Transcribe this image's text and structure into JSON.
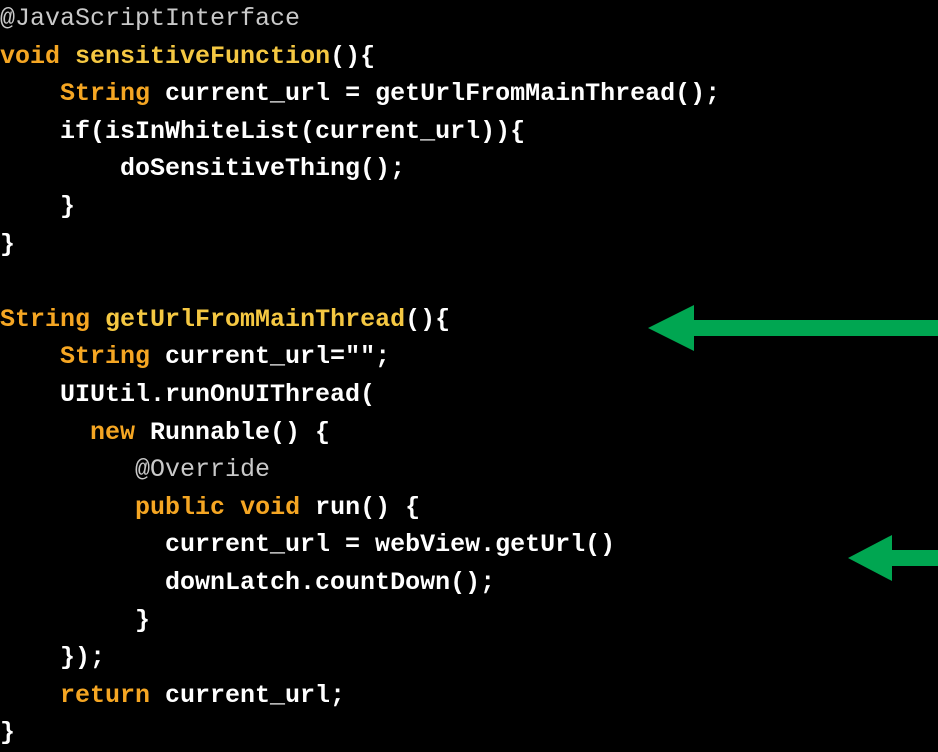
{
  "code_lines": [
    [
      {
        "t": "@JavaScriptInterface",
        "k": "ann"
      }
    ],
    [
      {
        "t": "void",
        "k": "kw"
      },
      {
        "t": " ",
        "k": "plain"
      },
      {
        "t": "sensitiveFunction",
        "k": "fn"
      },
      {
        "t": "(){",
        "k": "plain"
      }
    ],
    [
      {
        "t": "    ",
        "k": "plain"
      },
      {
        "t": "String",
        "k": "kw"
      },
      {
        "t": " current_url = getUrlFromMainThread();",
        "k": "plain"
      }
    ],
    [
      {
        "t": "    if(isInWhiteList(current_url)){",
        "k": "plain"
      }
    ],
    [
      {
        "t": "        doSensitiveThing();",
        "k": "plain"
      }
    ],
    [
      {
        "t": "    }",
        "k": "plain"
      }
    ],
    [
      {
        "t": "}",
        "k": "plain"
      }
    ],
    [
      {
        "t": "",
        "k": "plain"
      }
    ],
    [
      {
        "t": "String",
        "k": "kw"
      },
      {
        "t": " ",
        "k": "plain"
      },
      {
        "t": "getUrlFromMainThread",
        "k": "fn"
      },
      {
        "t": "(){",
        "k": "plain"
      }
    ],
    [
      {
        "t": "    ",
        "k": "plain"
      },
      {
        "t": "String",
        "k": "kw"
      },
      {
        "t": " current_url=\"\";",
        "k": "plain"
      }
    ],
    [
      {
        "t": "    UIUtil.runOnUIThread(",
        "k": "plain"
      }
    ],
    [
      {
        "t": "      ",
        "k": "plain"
      },
      {
        "t": "new",
        "k": "kw"
      },
      {
        "t": " Runnable() {",
        "k": "plain"
      }
    ],
    [
      {
        "t": "         ",
        "k": "plain"
      },
      {
        "t": "@Override",
        "k": "ann"
      }
    ],
    [
      {
        "t": "         ",
        "k": "plain"
      },
      {
        "t": "public",
        "k": "kw"
      },
      {
        "t": " ",
        "k": "plain"
      },
      {
        "t": "void",
        "k": "kw"
      },
      {
        "t": " run() {",
        "k": "plain"
      }
    ],
    [
      {
        "t": "           current_url = webView.getUrl()",
        "k": "plain"
      }
    ],
    [
      {
        "t": "           downLatch.countDown();",
        "k": "plain"
      }
    ],
    [
      {
        "t": "         }",
        "k": "plain"
      }
    ],
    [
      {
        "t": "    });",
        "k": "plain"
      }
    ],
    [
      {
        "t": "    ",
        "k": "plain"
      },
      {
        "t": "return",
        "k": "kw"
      },
      {
        "t": " current_url;",
        "k": "plain"
      }
    ],
    [
      {
        "t": "}",
        "k": "plain"
      }
    ]
  ],
  "colors": {
    "background": "#000000",
    "plain": "#ffffff",
    "annotation": "#c9c9c9",
    "keyword": "#f5a623",
    "function_name": "#f5c842",
    "arrow": "#00a651"
  },
  "arrows": [
    {
      "icon": "arrow-left-icon",
      "points_to_line": 9
    },
    {
      "icon": "arrow-left-icon",
      "points_to_line": 15
    }
  ]
}
